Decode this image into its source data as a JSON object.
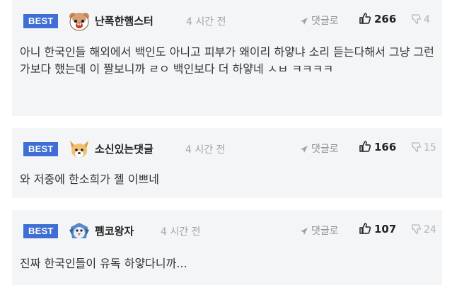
{
  "comments": [
    {
      "badge": "BEST",
      "nickname": "난폭한햄스터",
      "time": "4 시간 전",
      "reply_label": "댓글로",
      "likes": "266",
      "dislikes": "4",
      "avatar_icon": "hamster-avatar-icon",
      "body": "아니 한국인들 해외에서 백인도 아니고 피부가 왜이리 하얗냐 소리 듣는다해서 그냥 그런가보다 했는데 이 짤보니까 ㄹㅇ 백인보다 더 하얗네 ㅅㅂ ㅋㅋㅋㅋ"
    },
    {
      "badge": "BEST",
      "nickname": "소신있는댓글",
      "time": "4 시간 전",
      "reply_label": "댓글로",
      "likes": "166",
      "dislikes": "15",
      "avatar_icon": "dog-avatar-icon",
      "body": "와 저중에 한소희가 젤 이쁘네"
    },
    {
      "badge": "BEST",
      "nickname": "펨코왕자",
      "time": "4 시간 전",
      "reply_label": "댓글로",
      "likes": "107",
      "dislikes": "24",
      "avatar_icon": "penguin-avatar-icon",
      "body": "진짜 한국인들이 유독 하얗다니까..."
    }
  ],
  "colors": {
    "badge": "#3f6fd4",
    "card_background": "#f4f5f7",
    "muted_text": "#a0a3a8"
  }
}
